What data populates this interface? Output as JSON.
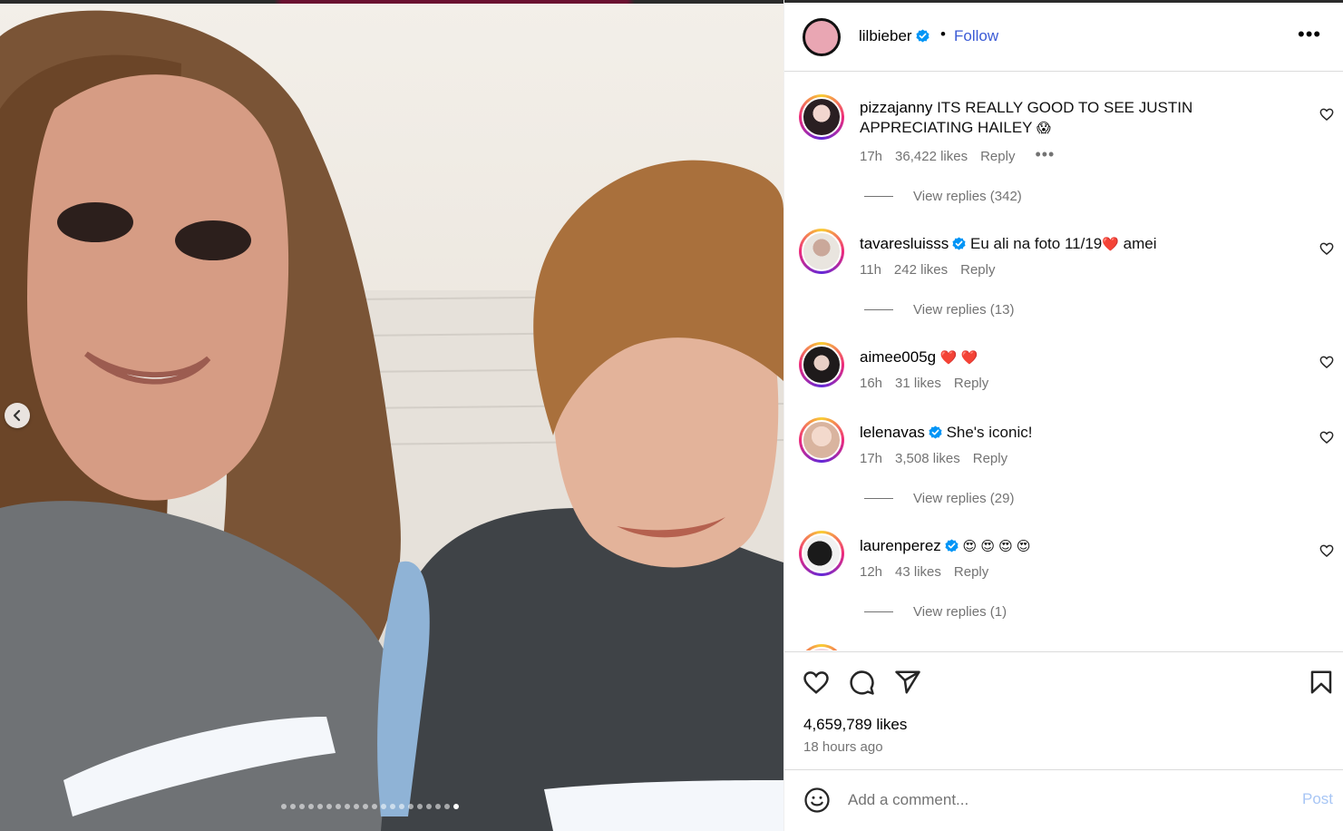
{
  "post": {
    "username": "lilbieber",
    "separator": "•",
    "follow_label": "Follow",
    "more_label": "•••"
  },
  "comments": [
    {
      "username": "pizzajanny",
      "verified": false,
      "text": "ITS REALLY GOOD TO SEE JUSTIN APPRECIATING HAILEY",
      "emoji": "😱",
      "time": "17h",
      "likes": "36,422 likes",
      "reply": "Reply",
      "options": "•••",
      "view_replies": "View replies (342)"
    },
    {
      "username": "tavaresluisss",
      "verified": true,
      "text": "Eu ali na foto 11/19",
      "emoji": "❤️",
      "text2": "amei",
      "time": "11h",
      "likes": "242 likes",
      "reply": "Reply",
      "view_replies": "View replies (13)"
    },
    {
      "username": "aimee005g",
      "verified": false,
      "text": "",
      "emoji": "❤️ ❤️",
      "time": "16h",
      "likes": "31 likes",
      "reply": "Reply"
    },
    {
      "username": "lelenavas",
      "verified": true,
      "text": "She's iconic!",
      "time": "17h",
      "likes": "3,508 likes",
      "reply": "Reply",
      "view_replies": "View replies (29)"
    },
    {
      "username": "laurenperez",
      "verified": true,
      "text": "",
      "emoji": "😍 😍 😍 😍",
      "time": "12h",
      "likes": "43 likes",
      "reply": "Reply",
      "view_replies": "View replies (1)"
    }
  ],
  "footer": {
    "likes": "4,659,789 likes",
    "time_ago": "18 hours ago",
    "comment_placeholder": "Add a comment...",
    "post_label": "Post"
  },
  "carousel": {
    "total_slides": 20,
    "active_slide": 20
  },
  "colors": {
    "follow": "#3b5bd6",
    "verified": "#0095f6",
    "post_disabled": "#a8c6f5",
    "muted": "#737373"
  },
  "icons": [
    "chevron-left-icon",
    "verified-badge-icon",
    "more-icon",
    "heart-icon",
    "comment-icon",
    "share-icon",
    "bookmark-icon",
    "emoji-icon"
  ]
}
